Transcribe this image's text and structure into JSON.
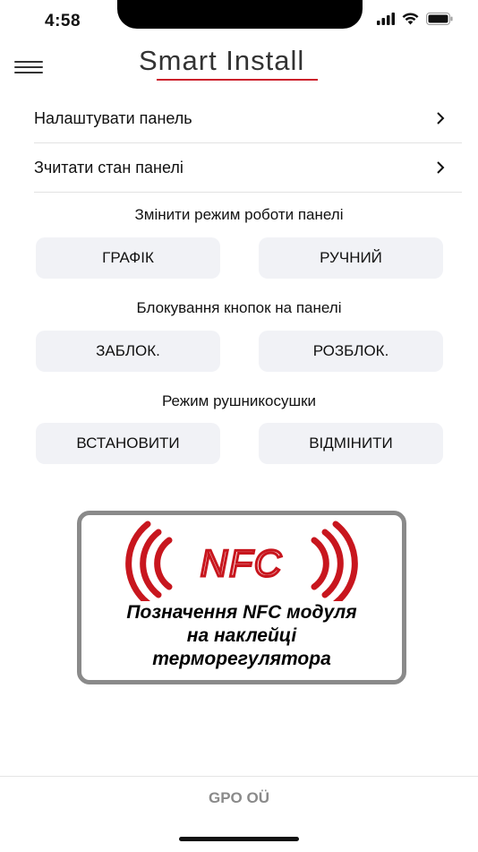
{
  "status_bar": {
    "time": "4:58"
  },
  "header": {
    "logo_text": "Smart Install"
  },
  "menu_rows": [
    {
      "label": "Налаштувати панель"
    },
    {
      "label": "Зчитати стан панелі"
    }
  ],
  "sections": [
    {
      "title": "Змінити режим роботи панелі",
      "buttons": [
        "ГРАФІК",
        "РУЧНИЙ"
      ]
    },
    {
      "title": "Блокування кнопок на панелі",
      "buttons": [
        "ЗАБЛОК.",
        "РОЗБЛОК."
      ]
    },
    {
      "title": "Режим рушникосушки",
      "buttons": [
        "ВСТАНОВИТИ",
        "ВІДМІНИТИ"
      ]
    }
  ],
  "nfc_card": {
    "logo_text": "NFC",
    "caption_lines": [
      "Позначення NFC модуля",
      "на  наклейці",
      "терморегулятора"
    ],
    "accent_color": "#c8161e"
  },
  "footer": {
    "text": "GPO OÜ"
  }
}
